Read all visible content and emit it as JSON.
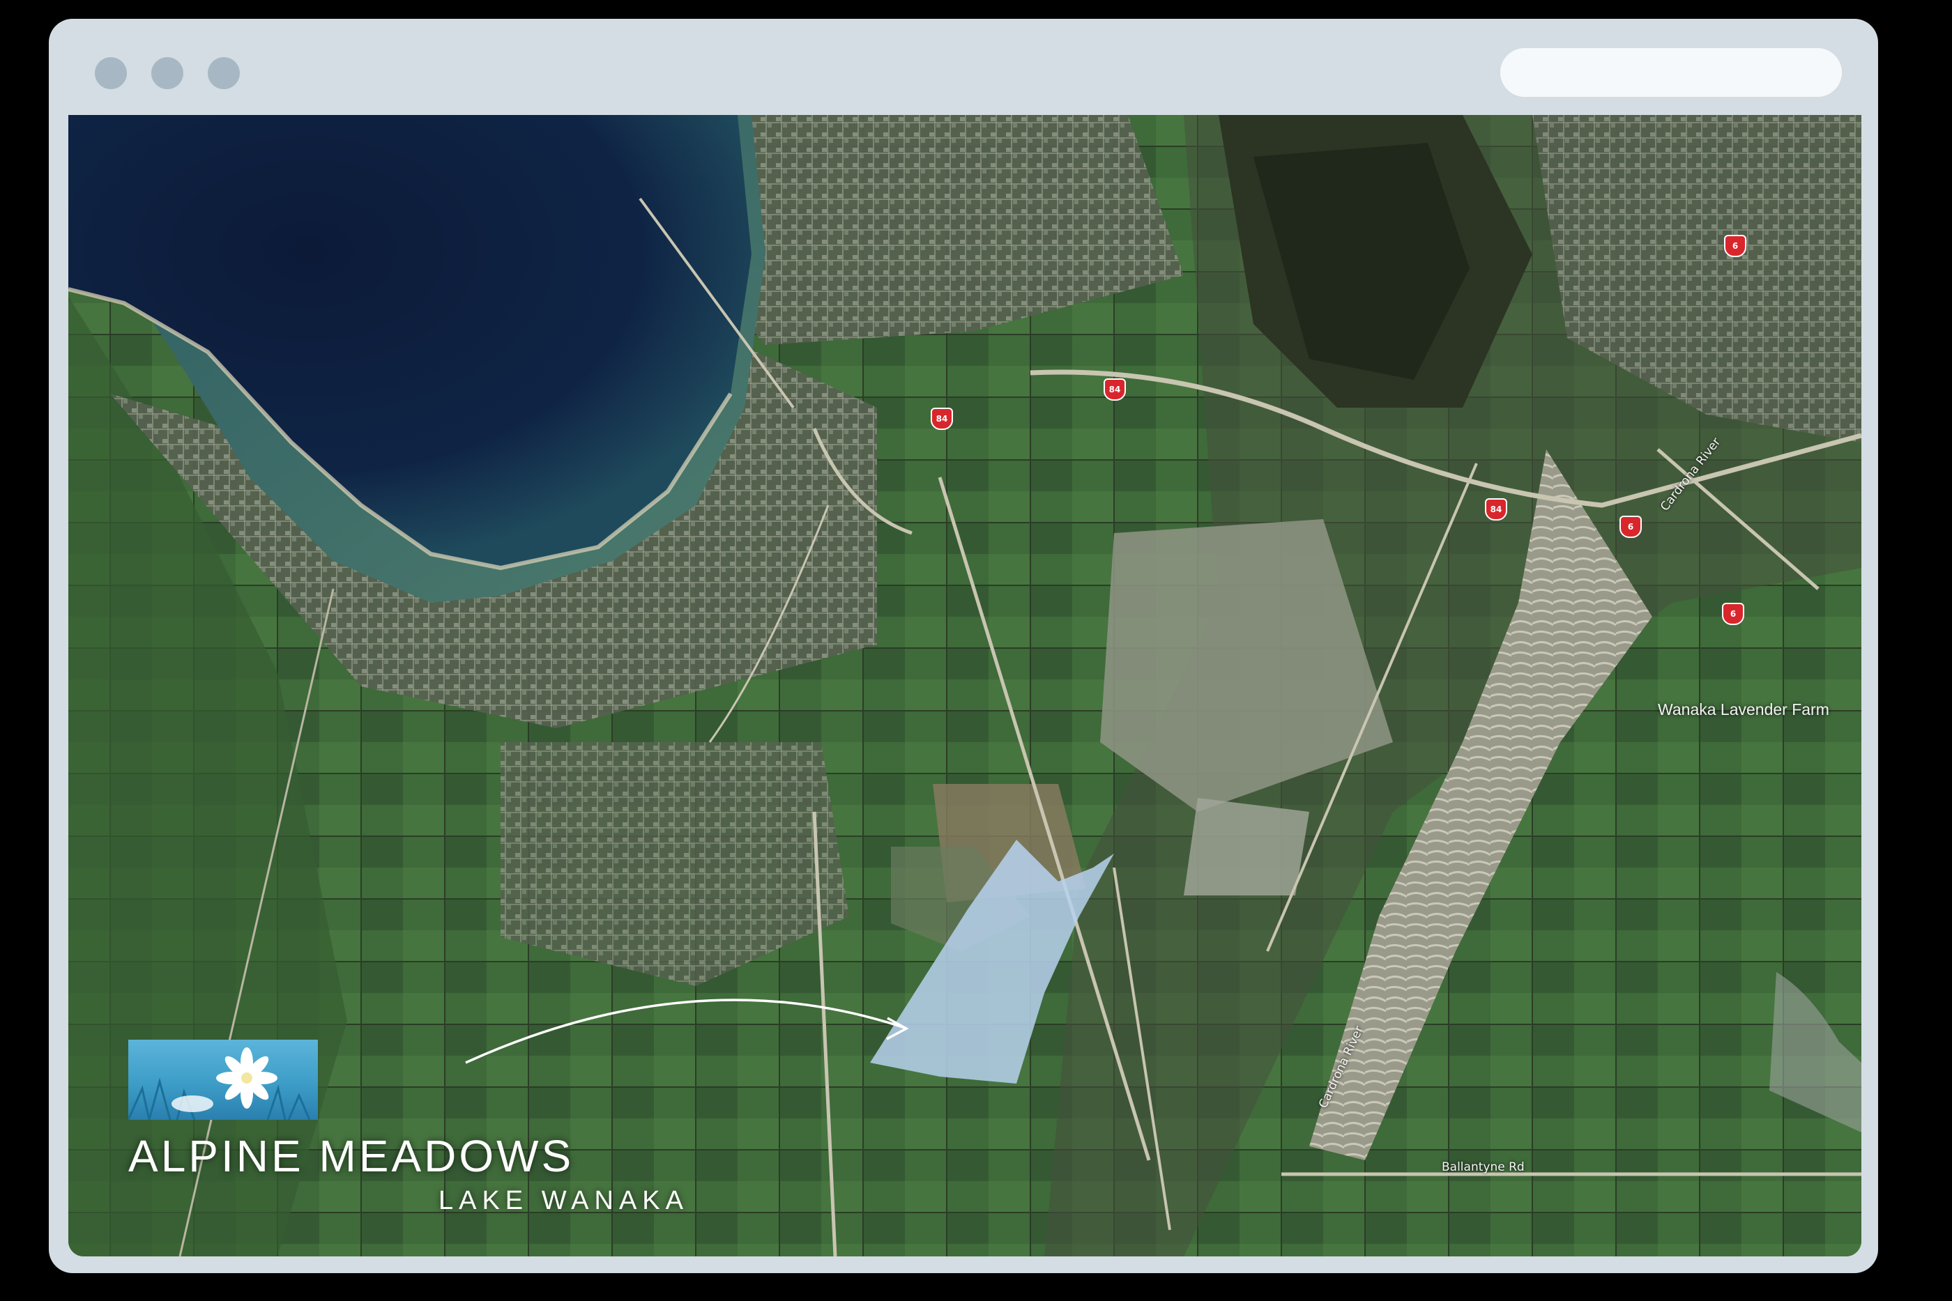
{
  "window": {
    "controls": [
      "close",
      "minimize",
      "maximize"
    ]
  },
  "map": {
    "type": "satellite",
    "place_labels": {
      "lavender_farm": "Wanaka Lavender Farm"
    },
    "road_labels": {
      "ballantyne": "Ballantyne Rd",
      "cardrona_river_upper": "Cardrona River",
      "cardrona_river_lower": "Cardrona River"
    },
    "route_shields": [
      "84",
      "84",
      "84",
      "6",
      "6",
      "6"
    ],
    "highlight_color": "#b7d1ef"
  },
  "logo": {
    "title": "ALPINE MEADOWS",
    "subtitle": "LAKE WANAKA",
    "emblem_colors": [
      "#5cb4da",
      "#2a7fae"
    ]
  }
}
